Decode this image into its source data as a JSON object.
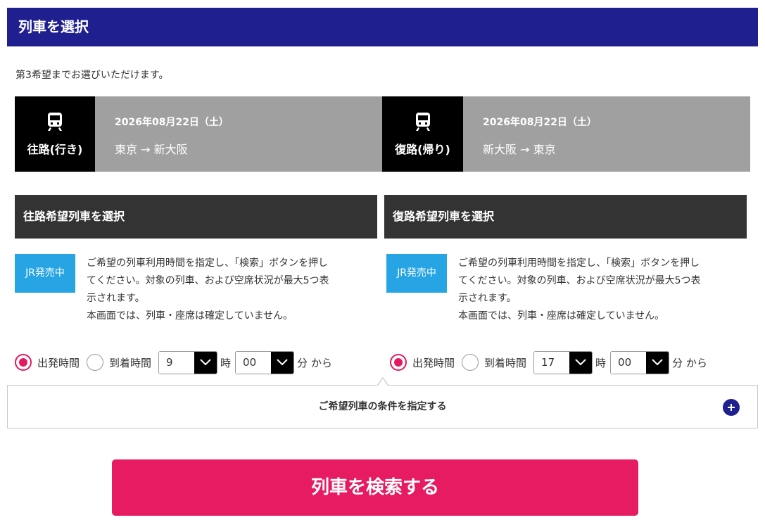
{
  "header": {
    "title": "列車を選択"
  },
  "intro": {
    "text": "第3希望までお選びいただけます。"
  },
  "outbound": {
    "badge_label": "往路(行き)",
    "date": "2026年08月22日（土）",
    "route": "東京 → 新大阪",
    "section_title": "往路希望列車を選択",
    "jr_badge": "JR発売中",
    "desc_line1": "ご希望の列車利用時間を指定し、「検索」ボタンを押し",
    "desc_line2": "てください。対象の列車、および空席状況が最大5つ表",
    "desc_line3": "示されます。",
    "desc_line4": "本画面では、列車・座席は確定していません。",
    "radio_depart": "出発時間",
    "radio_arrive": "到着時間",
    "selected_mode": "depart",
    "hour": "9",
    "hour_unit": "時",
    "minute": "00",
    "minute_unit": "分 から"
  },
  "return": {
    "badge_label": "復路(帰り)",
    "date": "2026年08月22日（土）",
    "route": "新大阪 → 東京",
    "section_title": "復路希望列車を選択",
    "jr_badge": "JR発売中",
    "desc_line1": "ご希望の列車利用時間を指定し、「検索」ボタンを押し",
    "desc_line2": "てください。対象の列車、および空席状況が最大5つ表",
    "desc_line3": "示されます。",
    "desc_line4": "本画面では、列車・座席は確定していません。",
    "radio_depart": "出発時間",
    "radio_arrive": "到着時間",
    "selected_mode": "depart",
    "hour": "17",
    "hour_unit": "時",
    "minute": "00",
    "minute_unit": "分 から"
  },
  "conditions": {
    "label": "ご希望列車の条件を指定する",
    "icon": "plus-icon"
  },
  "search_button": {
    "label": "列車を検索する"
  },
  "colors": {
    "header": "#1f1f8f",
    "accent": "#e61b62",
    "jr_badge": "#27a4e3"
  }
}
